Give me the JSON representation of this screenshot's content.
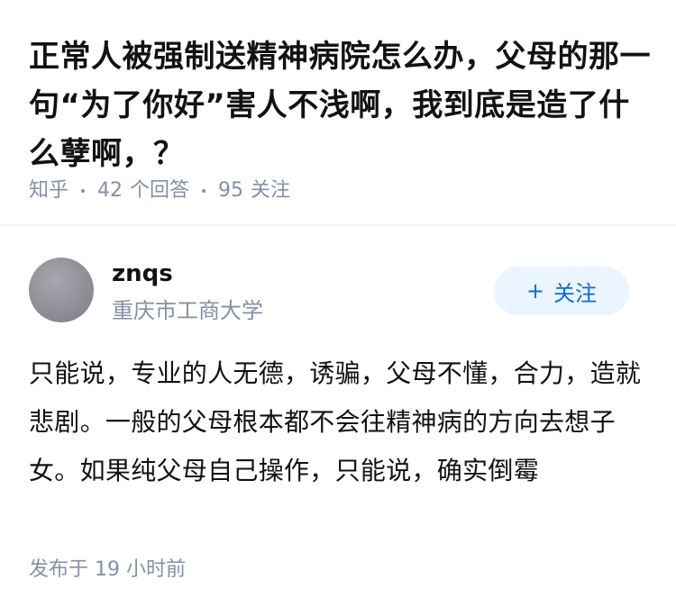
{
  "question": {
    "title": "正常人被强制送精神病院怎么办，父母的那一句“为了你好”害人不浅啊，我到底是造了什么孽啊，？",
    "source": "知乎",
    "answer_count": "42",
    "answer_label": "个回答",
    "follow_count": "95",
    "follow_label": "关注"
  },
  "answer": {
    "author_name": "znqs",
    "author_school": "重庆市工商大学",
    "follow_button_label": "关注",
    "content": "只能说，专业的人无德，诱骗，父母不懂，合力，造就悲剧。一般的父母根本都不会往精神病的方向去想子女。如果纯父母自己操作，只能说，确实倒霉",
    "published": "发布于 19 小时前"
  },
  "colors": {
    "accent": "#056de8",
    "accent_bg": "#ebf5ff",
    "muted_text": "#8590a6",
    "main_text": "#121212"
  }
}
